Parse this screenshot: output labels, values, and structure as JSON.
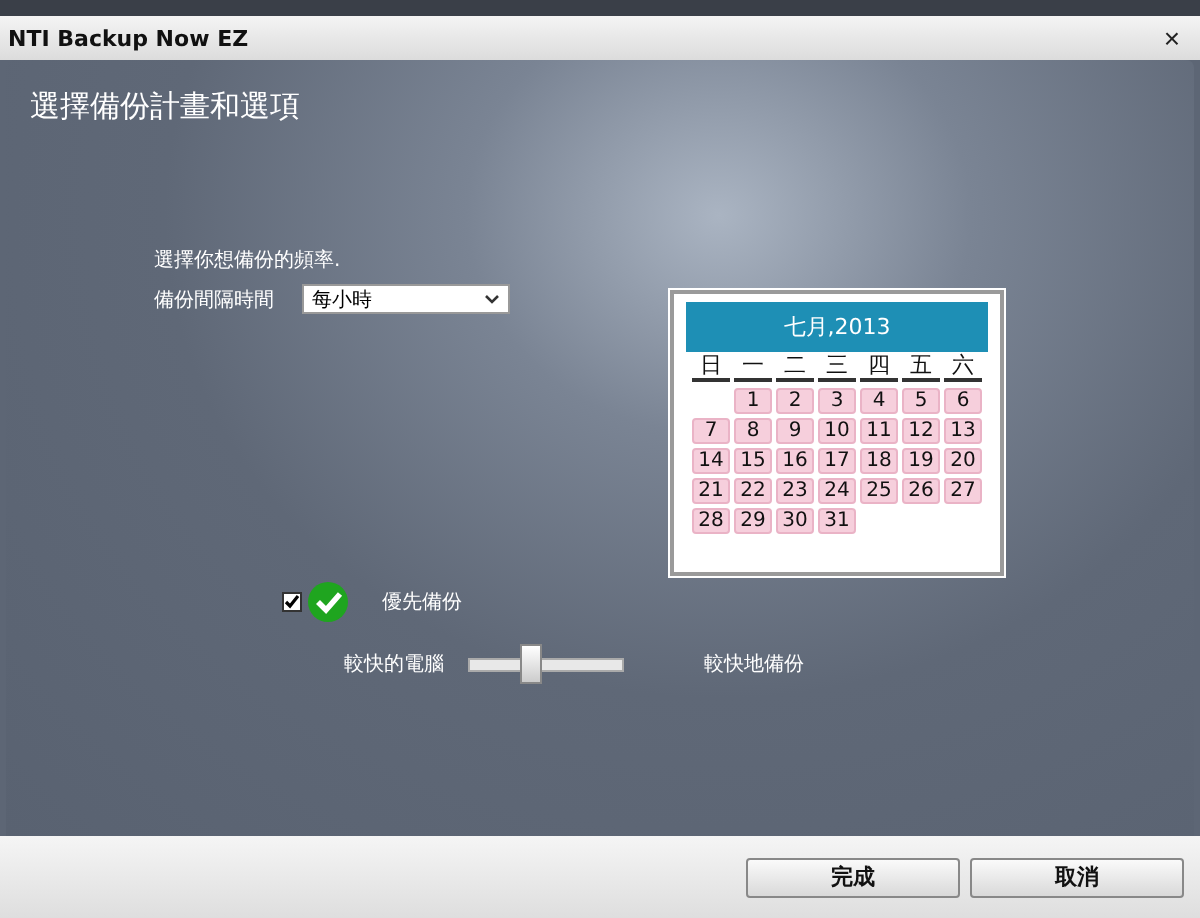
{
  "window": {
    "title": "NTI Backup Now EZ",
    "close": "×"
  },
  "heading": "選擇備份計畫和選項",
  "frequency": {
    "prompt": "選擇你想備份的頻率.",
    "label": "備份間隔時間",
    "value": "每小時"
  },
  "calendar": {
    "title": "七月,2013",
    "weekdays": [
      "日",
      "一",
      "二",
      "三",
      "四",
      "五",
      "六"
    ],
    "weeks": [
      {
        "kind": "first",
        "days": [
          "1",
          "2",
          "3",
          "4",
          "5",
          "6"
        ]
      },
      {
        "kind": "full",
        "days": [
          "7",
          "8",
          "9",
          "10",
          "11",
          "12",
          "13"
        ]
      },
      {
        "kind": "full",
        "days": [
          "14",
          "15",
          "16",
          "17",
          "18",
          "19",
          "20"
        ]
      },
      {
        "kind": "full",
        "days": [
          "21",
          "22",
          "23",
          "24",
          "25",
          "26",
          "27"
        ]
      },
      {
        "kind": "last",
        "days": [
          "28",
          "29",
          "30",
          "31"
        ]
      }
    ]
  },
  "priority": {
    "label": "優先備份",
    "checked": true
  },
  "speed": {
    "left_label": "較快的電腦",
    "right_label": "較快地備份",
    "level": 0.4
  },
  "buttons": [
    "完成",
    "取消"
  ]
}
